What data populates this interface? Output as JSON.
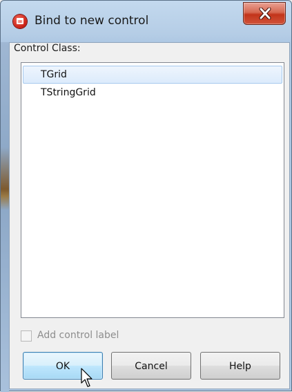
{
  "window": {
    "title": "Bind to new control",
    "icon": "app-icon",
    "close_glyph": "X"
  },
  "control_class": {
    "label": "Control Class:",
    "items": [
      {
        "label": "TGrid",
        "selected": true
      },
      {
        "label": "TStringGrid",
        "selected": false
      }
    ]
  },
  "add_label_checkbox": {
    "label": "Add control label",
    "checked": false,
    "enabled": false
  },
  "buttons": {
    "ok": "OK",
    "cancel": "Cancel",
    "help": "Help"
  },
  "colors": {
    "selection": "#dcebfc",
    "default_button": "#bee6fd",
    "close_button": "#c2341a"
  }
}
